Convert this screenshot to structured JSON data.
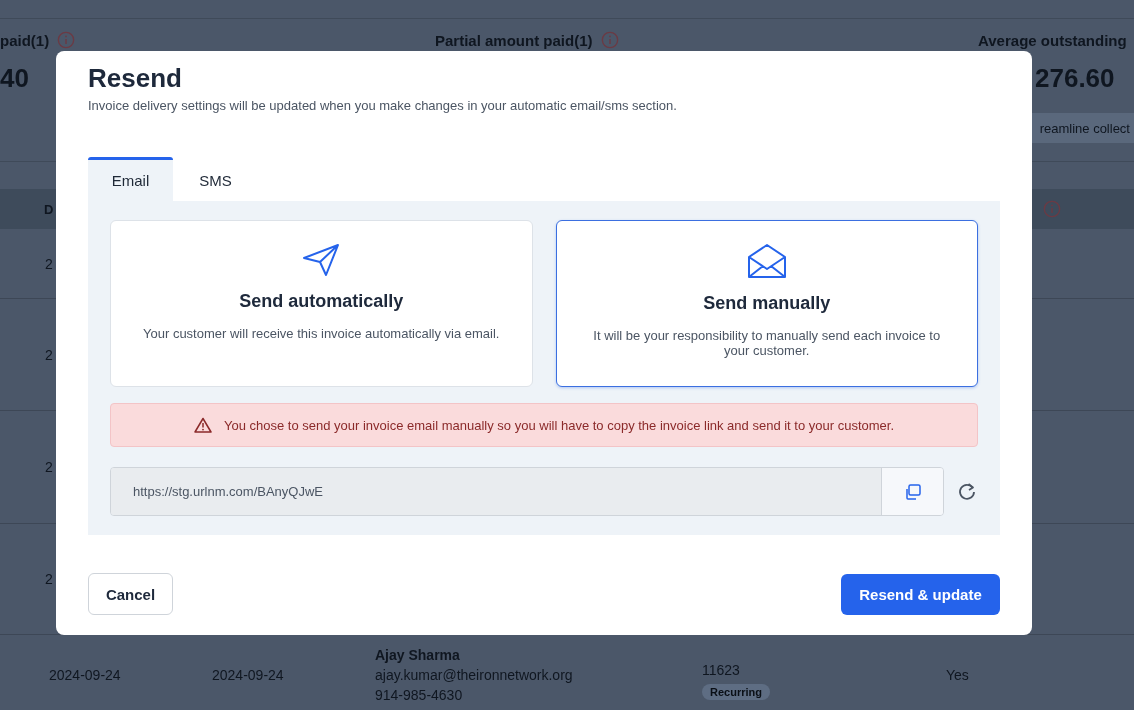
{
  "page": {
    "stats": [
      {
        "label": "paid(1)",
        "value": "40"
      },
      {
        "label": "Partial amount paid(1)"
      },
      {
        "label": "Average outstanding",
        "value": "276.60"
      }
    ],
    "chip": "reamline collect",
    "table_header": "D",
    "row_starts": [
      "2",
      "2",
      "2",
      "2"
    ],
    "last_row": {
      "date_1": "2024-09-24",
      "date_2": "2024-09-24",
      "customer_name": "Ajay Sharma",
      "customer_email": "ajay.kumar@theironnetwork.org",
      "customer_phone": "914-985-4630",
      "number": "11623",
      "badge": "Recurring",
      "flag": "Yes"
    }
  },
  "dialog": {
    "title": "Resend",
    "subtitle": "Invoice delivery settings will be updated when you make changes in your automatic email/sms section.",
    "tabs": [
      {
        "label": "Email",
        "selected": true
      },
      {
        "label": "SMS",
        "selected": false
      }
    ],
    "options": [
      {
        "kind": "auto",
        "title": "Send automatically",
        "description": "Your customer will receive this invoice automatically via email.",
        "selected": false
      },
      {
        "kind": "manual",
        "title": "Send manually",
        "description": "It will be your responsibility to manually send each invoice to your customer.",
        "selected": true
      }
    ],
    "alert": "You chose to send your invoice email manually so you will have to copy the invoice link and send it to your customer.",
    "link": "https://stg.urlnm.com/BAnyQJwE",
    "buttons": {
      "cancel": "Cancel",
      "confirm": "Resend & update"
    }
  }
}
